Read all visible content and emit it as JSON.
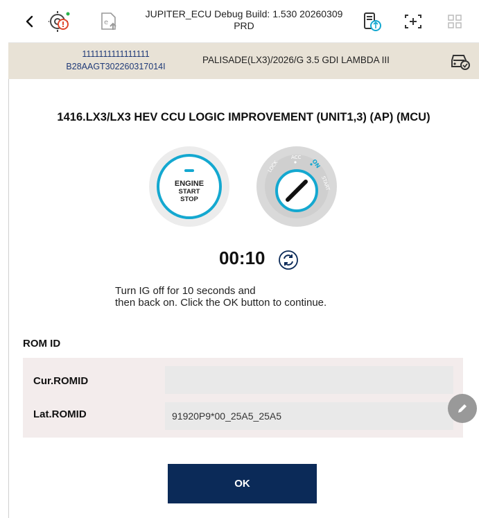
{
  "header": {
    "title_line1": "JUPITER_ECU Debug Build: 1.530 20260309",
    "title_line2": "PRD",
    "icons": [
      "back-icon",
      "diagnostic-warning-icon",
      "e-upload-icon",
      "usb-device-icon",
      "screenshot-frame-icon",
      "grid-menu-icon"
    ]
  },
  "vehicle": {
    "vin_line1": "1111111111111111",
    "vin_line2": "B28AAGT302260317014I",
    "model": "PALISADE(LX3)/2026/G 3.5 GDI LAMBDA III",
    "icon": "car-check-icon"
  },
  "procedure": {
    "title": "1416.LX3/LX3 HEV CCU LOGIC IMPROVEMENT (UNIT1,3) (AP) (MCU)",
    "engine_button": {
      "line1": "ENGINE",
      "line2": "START",
      "line3": "STOP"
    },
    "ignition_key": {
      "lock": "LOCK",
      "acc": "ACC",
      "on": "ON",
      "start": "START"
    },
    "timer": "00:10",
    "instruction_line1": "Turn IG off for 10 seconds and",
    "instruction_line2": "then back on. Click the OK button to continue."
  },
  "rom": {
    "heading": "ROM ID",
    "cur_label": "Cur.ROMID",
    "cur_value": "",
    "lat_label": "Lat.ROMID",
    "lat_value": "91920P9*00_25A5_25A5"
  },
  "actions": {
    "ok_label": "OK"
  },
  "colors": {
    "accent": "#14a8d0",
    "primary_button": "#0b2a58",
    "vehicle_bar": "#e8e2d6",
    "vin_text": "#1f3a78"
  }
}
